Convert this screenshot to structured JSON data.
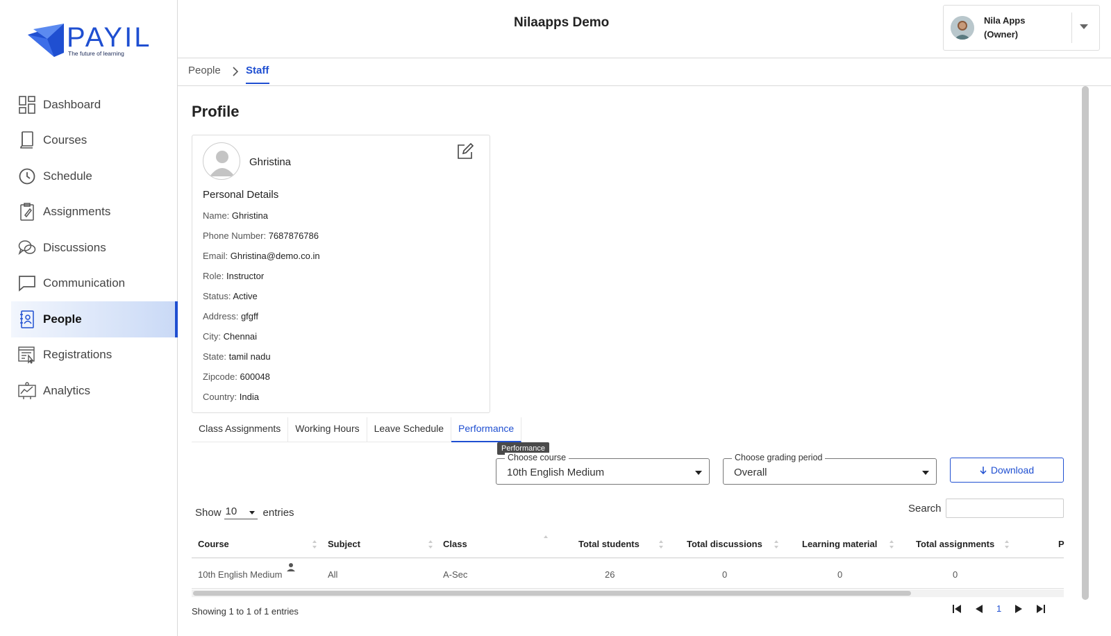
{
  "brand": {
    "name": "PAYIL",
    "tagline": "The future of learning"
  },
  "sidebar": {
    "items": [
      {
        "label": "Dashboard",
        "icon": "dashboard-icon"
      },
      {
        "label": "Courses",
        "icon": "book-icon"
      },
      {
        "label": "Schedule",
        "icon": "clock-icon"
      },
      {
        "label": "Assignments",
        "icon": "clipboard-icon"
      },
      {
        "label": "Discussions",
        "icon": "chat-bubbles-icon"
      },
      {
        "label": "Communication",
        "icon": "message-icon"
      },
      {
        "label": "People",
        "icon": "contact-book-icon",
        "active": true
      },
      {
        "label": "Registrations",
        "icon": "registration-icon"
      },
      {
        "label": "Analytics",
        "icon": "analytics-icon"
      }
    ]
  },
  "header": {
    "title": "Nilaapps Demo",
    "user": {
      "name": "Nila Apps",
      "role": "(Owner)"
    }
  },
  "breadcrumb": {
    "parent": "People",
    "current": "Staff"
  },
  "profile": {
    "title": "Profile",
    "name": "Ghristina",
    "section_title": "Personal Details",
    "fields": [
      {
        "label": "Name:",
        "value": "Ghristina"
      },
      {
        "label": "Phone Number:",
        "value": "7687876786"
      },
      {
        "label": "Email:",
        "value": "Ghristina@demo.co.in"
      },
      {
        "label": "Role:",
        "value": "Instructor"
      },
      {
        "label": "Status:",
        "value": "Active"
      },
      {
        "label": "Address:",
        "value": "gfgff"
      },
      {
        "label": "City:",
        "value": "Chennai"
      },
      {
        "label": "State:",
        "value": "tamil nadu"
      },
      {
        "label": "Zipcode:",
        "value": "600048"
      },
      {
        "label": "Country:",
        "value": "India"
      }
    ]
  },
  "tabs": [
    "Class Assignments",
    "Working Hours",
    "Leave Schedule",
    "Performance"
  ],
  "active_tab": "Performance",
  "tooltip": "Performance",
  "filters": {
    "course": {
      "label": "Choose course",
      "value": "10th English Medium"
    },
    "grading": {
      "label": "Choose grading period",
      "value": "Overall"
    },
    "download_label": "Download"
  },
  "table": {
    "show_label": "Show",
    "entries_value": "10",
    "entries_label": "entries",
    "search_label": "Search",
    "columns": [
      "Course",
      "Subject",
      "Class",
      "Total students",
      "Total discussions",
      "Learning material",
      "Total assignments",
      "P"
    ],
    "rows": [
      {
        "course": "10th English Medium",
        "subject": "All",
        "class": "A-Sec",
        "students": "26",
        "discussions": "0",
        "material": "0",
        "assignments": "0"
      }
    ],
    "showing": "Showing 1 to 1 of 1 entries",
    "page": "1"
  },
  "colors": {
    "accent": "#1f4fd1",
    "active_bg": "#c9d9f6"
  }
}
